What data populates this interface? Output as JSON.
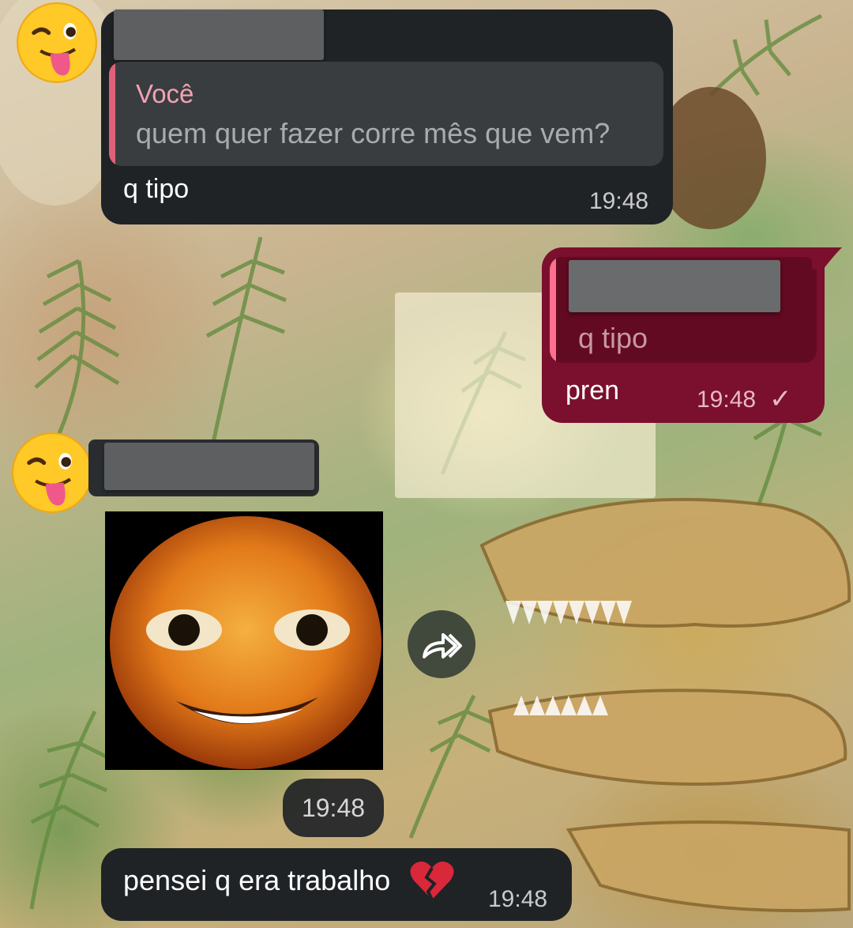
{
  "chat": {
    "msg1": {
      "reply": {
        "author": "Você",
        "text": "quem quer fazer corre mês que vem?"
      },
      "text": "q tipo",
      "time": "19:48"
    },
    "msg2": {
      "reply": {
        "text": "q tipo"
      },
      "text": "pren",
      "time": "19:48",
      "status": "✓"
    },
    "msg3": {
      "media": "smiling-orange-face-image",
      "time": "19:48"
    },
    "msg4": {
      "text": "pensei q era trabalho",
      "emoji": "broken-heart-icon",
      "time": "19:48"
    }
  },
  "colors": {
    "incoming_bubble": "#202326",
    "outgoing_bubble": "#7b0f2e",
    "quote_author": "#f2a3b3",
    "quote_bar_in": "#e0607a",
    "quote_bar_out": "#ff6f8e"
  }
}
